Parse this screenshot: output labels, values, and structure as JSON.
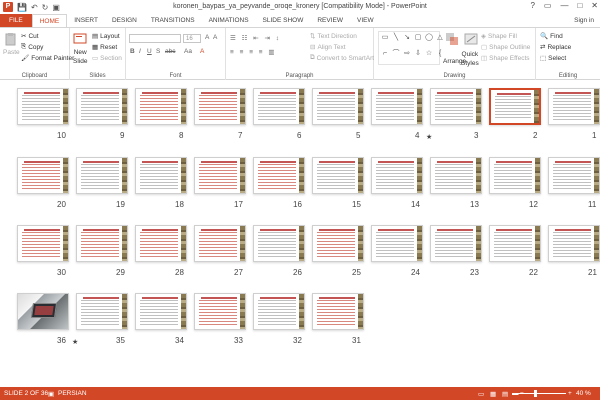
{
  "window": {
    "title": "koronen_baypas_ya_peyvande_oroqe_kronery [Compatibility Mode] - PowerPoint",
    "controls": [
      "?",
      "▭",
      "—",
      "□",
      "✕"
    ]
  },
  "qat": {
    "save": "💾",
    "undo": "↶",
    "redo": "↻",
    "present": "▣"
  },
  "tabs": [
    "FILE",
    "HOME",
    "INSERT",
    "DESIGN",
    "TRANSITIONS",
    "ANIMATIONS",
    "SLIDE SHOW",
    "REVIEW",
    "VIEW"
  ],
  "active_tab": "HOME",
  "signin": "Sign in",
  "ribbon": {
    "clipboard": {
      "paste": "Paste",
      "cut": "Cut",
      "copy": "Copy",
      "format_painter": "Format Painter",
      "label": "Clipboard"
    },
    "slides": {
      "new_slide": "New",
      "new_slide2": "Slide",
      "layout": "Layout",
      "reset": "Reset",
      "section": "Section",
      "label": "Slides"
    },
    "font": {
      "size": "16",
      "label": "Font",
      "bold": "B",
      "italic": "I",
      "underline": "U",
      "strike": "S",
      "shadow": "abc",
      "aa": "Aa"
    },
    "paragraph": {
      "text_direction": "Text Direction",
      "align_text": "Align Text",
      "convert_smartart": "Convert to SmartArt",
      "label": "Paragraph"
    },
    "drawing": {
      "arrange": "Arrange",
      "quick_styles": "Quick",
      "quick_styles2": "Styles",
      "shape_fill": "Shape Fill",
      "shape_outline": "Shape Outline",
      "shape_effects": "Shape Effects",
      "label": "Drawing"
    },
    "editing": {
      "find": "Find",
      "replace": "Replace",
      "select": "Select",
      "label": "Editing"
    }
  },
  "slides": [
    {
      "n": "10"
    },
    {
      "n": "9"
    },
    {
      "n": "8"
    },
    {
      "n": "7"
    },
    {
      "n": "6"
    },
    {
      "n": "5"
    },
    {
      "n": "4"
    },
    {
      "n": "3"
    },
    {
      "n": "2"
    },
    {
      "n": "1"
    },
    {
      "n": "20"
    },
    {
      "n": "19"
    },
    {
      "n": "18"
    },
    {
      "n": "17"
    },
    {
      "n": "16"
    },
    {
      "n": "15"
    },
    {
      "n": "14"
    },
    {
      "n": "13"
    },
    {
      "n": "12"
    },
    {
      "n": "11"
    },
    {
      "n": "30"
    },
    {
      "n": "29"
    },
    {
      "n": "28"
    },
    {
      "n": "27"
    },
    {
      "n": "26"
    },
    {
      "n": "25"
    },
    {
      "n": "24"
    },
    {
      "n": "23"
    },
    {
      "n": "22"
    },
    {
      "n": "21"
    },
    {
      "n": "36"
    },
    {
      "n": "35"
    },
    {
      "n": "34"
    },
    {
      "n": "33"
    },
    {
      "n": "32"
    },
    {
      "n": "31"
    }
  ],
  "selected_slide": "2",
  "star_marks": {
    "slide3": "★",
    "slide35": "★"
  },
  "status": {
    "slide_of": "SLIDE 2 OF 36",
    "language": "PERSIAN",
    "zoom": "40 %",
    "minus": "−",
    "plus": "+"
  },
  "colors": {
    "accent": "#d24726"
  }
}
